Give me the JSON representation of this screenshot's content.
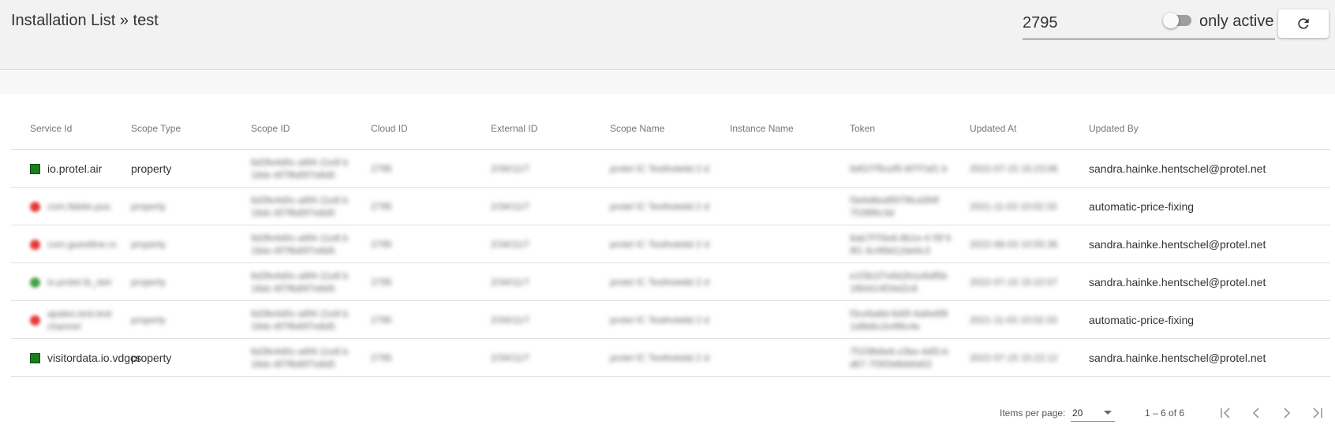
{
  "header": {
    "title": "Installation List » test",
    "search_value": "2795",
    "toggle_label": "only active",
    "refresh_icon": "refresh-icon"
  },
  "table": {
    "columns": [
      "Service Id",
      "Scope Type",
      "Scope ID",
      "Cloud ID",
      "External ID",
      "Scope Name",
      "Instance Name",
      "Token",
      "Updated At",
      "Updated By"
    ],
    "rows": [
      {
        "status": "active",
        "status_color": "#1a7f1a",
        "service_id": "io.protel.air",
        "scope_type": "property",
        "scope_id": "6d3fe4d0c-a6f4-11e8 b 18dc-6f7f6d0f7e8d5",
        "cloud_id": "2795",
        "external_id": "2/34/11/7",
        "scope_name": "protel IC Testhotelid 2 d",
        "token": "6df1f7f5cef5-6f7f7af1 b",
        "updated_at": "2022-07-15 15:23:06",
        "updated_by": "sandra.hainke.hentschel@protel.net",
        "blur_service": false,
        "blur_type": false
      },
      {
        "status": "error",
        "status_color": "#e53935",
        "service_id": "com.fidelio.pos",
        "scope_type": "property",
        "scope_id": "6d3fe4d0c-a6f4-11e8 b 18dc-6f7f6d0f7e8d5",
        "cloud_id": "2795",
        "external_id": "2/34/11/7",
        "scope_name": "protel IC Testhotelid 2 d",
        "token": "f3e6d6edf5f7f6cd3f4f 7f1f8f6c3d",
        "updated_at": "2021-11-03 10:02:33",
        "updated_by": "automatic-price-fixing",
        "blur_service": true,
        "blur_type": true
      },
      {
        "status": "error",
        "status_color": "#e53935",
        "service_id": "com.guestline.rs",
        "scope_type": "property",
        "scope_id": "6d3fe4d0c-a6f4-11e8 b 18dc-6f7f6d0f7e8d5",
        "cloud_id": "2795",
        "external_id": "2/34/11/7",
        "scope_name": "protel IC Testhotelid 2 d",
        "token": "6ab7f7f3e6-8b1e-4 f3f 6 9f1 6c4f9d12de6c3",
        "updated_at": "2022-06-03 10:55:36",
        "updated_by": "sandra.hainke.hentschel@protel.net",
        "blur_service": true,
        "blur_type": true
      },
      {
        "status": "active",
        "status_color": "#43a047",
        "service_id": "io.protel.ib_stel",
        "scope_type": "property",
        "scope_id": "6d3fe4d0c-a6f4-11e8 b 18dc-6f7f6d0f7e8d5",
        "cloud_id": "2795",
        "external_id": "2/34/11/7",
        "scope_name": "protel IC Testhotelid 2 d",
        "token": "e1f3b1f7e6d2b1e6df5b 1f64414f34d2c6",
        "updated_at": "2022-07-15 15:22:57",
        "updated_by": "sandra.hainke.hentschel@protel.net",
        "blur_service": true,
        "blur_type": true
      },
      {
        "status": "error",
        "status_color": "#e53935",
        "service_id": "apaleo.test.test channel",
        "scope_type": "property",
        "scope_id": "6d3fe4d0c-a6f4-11e8 b 18dc-6f7f6d0f7e8d5",
        "cloud_id": "2795",
        "external_id": "2/34/11/7",
        "scope_name": "protel IC Testhotelid 2 d",
        "token": "f3ce6a8d-6d0f-4a6e6f9 1d6b6c2e4f6c4e",
        "updated_at": "2021-11-03 10:02:33",
        "updated_by": "automatic-price-fixing",
        "blur_service": true,
        "blur_type": true
      },
      {
        "status": "active",
        "status_color": "#1a7f1a",
        "service_id": "visitordata.io.vdgcs",
        "scope_type": "property",
        "scope_id": "6d3fe4d0c-a6f4-11e8 b 18dc-6f7f6d0f7e8d5",
        "cloud_id": "2795",
        "external_id": "2/34/11/7",
        "scope_name": "protel IC Testhotelid 2 d",
        "token": "7f1f3fb6e6-c0be-4df3-b d67-7f3f2b6bb6d02",
        "updated_at": "2022-07-15 15:22:12",
        "updated_by": "sandra.hainke.hentschel@protel.net",
        "blur_service": false,
        "blur_type": false
      }
    ]
  },
  "paginator": {
    "items_label": "Items per page:",
    "page_size": "20",
    "range_label": "1 – 6 of 6"
  }
}
